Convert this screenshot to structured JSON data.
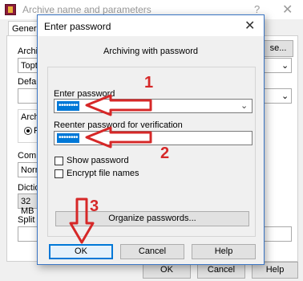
{
  "background_window": {
    "title": "Archive name and parameters",
    "help": "?",
    "close": "✕",
    "tab_general": "General",
    "archive_label": "Archive",
    "archive_value": "Topthe",
    "browse_button": "se...",
    "default_label": "Default",
    "archive_format_label": "Archiv",
    "radio_label": "RA",
    "compression_label": "Compre",
    "compression_value": "Norma",
    "dictionary_label": "Dictiona",
    "dictionary_value": "32 MB",
    "split_label": "Split to",
    "ok_button": "OK",
    "cancel_button": "Cancel",
    "help_button": "Help"
  },
  "dialog": {
    "title": "Enter password",
    "close": "✕",
    "heading": "Archiving with password",
    "enter_password_label": "Enter password",
    "enter_password_value": "••••••••",
    "reenter_label": "Reenter password for verification",
    "reenter_value": "••••••••",
    "show_password_label": "Show password",
    "encrypt_names_label": "Encrypt file names",
    "organize_button": "Organize passwords...",
    "ok_button": "OK",
    "cancel_button": "Cancel",
    "help_button": "Help"
  },
  "annotations": {
    "step1": "1",
    "step2": "2",
    "step3": "3",
    "color": "#d62828"
  }
}
